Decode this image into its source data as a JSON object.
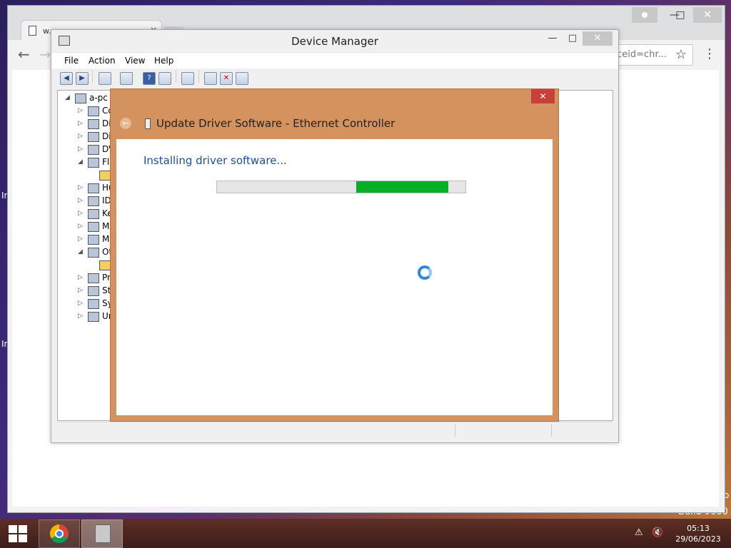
{
  "desktop": {
    "left_text_1": "In",
    "left_text_2": "In",
    "right_text": "o",
    "build": "Build 9600"
  },
  "chrome": {
    "tab_title": "w...",
    "tab_close": "×",
    "minimize": "—",
    "maximize": "□",
    "close": "✕",
    "user_icon": "person-icon",
    "back": "←",
    "forward": "→",
    "address_fragment": "rceid=chr...",
    "star": "☆",
    "menu": "⋮"
  },
  "device_manager": {
    "title": "Device Manager",
    "minimize": "—",
    "maximize": "□",
    "close": "✕",
    "menu": [
      "File",
      "Action",
      "View",
      "Help"
    ],
    "toolbar": [
      "back-icon",
      "forward-icon",
      "properties-icon",
      "tree-view-icon",
      "help-icon",
      "computer-view-icon",
      "scan-hardware-icon",
      "update-driver-icon",
      "uninstall-icon",
      "disable-icon"
    ],
    "tree": {
      "root": "a-pc",
      "items": [
        {
          "exp": "▷",
          "label": "Co"
        },
        {
          "exp": "▷",
          "label": "Di"
        },
        {
          "exp": "▷",
          "label": "Di"
        },
        {
          "exp": "▷",
          "label": "DV"
        },
        {
          "exp": "◢",
          "label": "Fl"
        },
        {
          "exp": "",
          "label": ""
        },
        {
          "exp": "▷",
          "label": "Hu"
        },
        {
          "exp": "▷",
          "label": "ID"
        },
        {
          "exp": "▷",
          "label": "Ke"
        },
        {
          "exp": "▷",
          "label": "M"
        },
        {
          "exp": "▷",
          "label": "M"
        },
        {
          "exp": "◢",
          "label": "Ot"
        },
        {
          "exp": "",
          "label": ""
        },
        {
          "exp": "▷",
          "label": "Pr"
        },
        {
          "exp": "▷",
          "label": "St"
        },
        {
          "exp": "▷",
          "label": "Sy"
        },
        {
          "exp": "▷",
          "label": "Ur"
        }
      ]
    }
  },
  "dialog": {
    "close": "✕",
    "back": "←",
    "title": "Update Driver Software - Ethernet Controller",
    "status": "Installing driver software...",
    "progress_start": 0.56,
    "progress_end": 0.93
  },
  "taskbar": {
    "time": "05:13",
    "date": "29/06/2023",
    "network_icon": "network-error-icon",
    "volume_icon": "volume-muted-icon"
  }
}
